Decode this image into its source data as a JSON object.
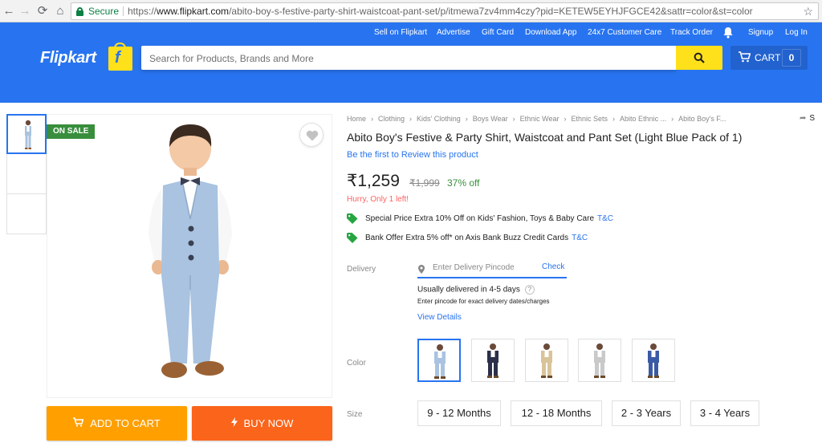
{
  "browser": {
    "secure_label": "Secure",
    "url_scheme": "https://",
    "url_host": "www.flipkart.com",
    "url_path": "/abito-boy-s-festive-party-shirt-waistcoat-pant-set/p/itmewa7zv4mm4czy?pid=KETEW5EYHJFGCE42&sattr=color&st=color"
  },
  "header": {
    "logo": "Flipkart",
    "links": [
      "Sell on Flipkart",
      "Advertise",
      "Gift Card",
      "Download App",
      "24x7 Customer Care",
      "Track Order",
      "Signup",
      "Log In"
    ],
    "search_placeholder": "Search for Products, Brands and More",
    "cart_label": "CART",
    "cart_count": "0"
  },
  "gallery": {
    "sale_badge": "ON SALE",
    "add_to_cart": "ADD TO CART",
    "buy_now": "BUY NOW"
  },
  "breadcrumbs": [
    "Home",
    "Clothing",
    "Kids' Clothing",
    "Boys Wear",
    "Ethnic Wear",
    "Ethnic Sets",
    "Abito Ethnic ...",
    "Abito Boy's F..."
  ],
  "share_label": "S",
  "product": {
    "title": "Abito Boy's Festive & Party Shirt, Waistcoat and Pant Set  (Light Blue Pack of 1)",
    "review_link": "Be the first to Review this product",
    "price": "₹1,259",
    "mrp": "₹1,999",
    "discount": "37% off",
    "hurry": "Hurry, Only 1 left!"
  },
  "offers": [
    {
      "text": "Special Price Extra 10% Off on Kids' Fashion, Toys & Baby Care",
      "tc": "T&C"
    },
    {
      "text": "Bank Offer Extra 5% off* on Axis Bank Buzz Credit Cards",
      "tc": "T&C"
    }
  ],
  "delivery": {
    "label": "Delivery",
    "placeholder": "Enter Delivery Pincode",
    "check": "Check",
    "eta": "Usually delivered in 4-5 days",
    "help": "?",
    "note": "Enter pincode for exact delivery dates/charges",
    "view_details": "View Details"
  },
  "color": {
    "label": "Color",
    "swatches": [
      {
        "vest": "#a9c3e0",
        "pants": "#a9c3e0",
        "shirt": "#ffffff"
      },
      {
        "vest": "#2b2f4a",
        "pants": "#2b2f4a",
        "shirt": "#ffffff"
      },
      {
        "vest": "#d9c49a",
        "pants": "#d9c49a",
        "shirt": "#ffffff"
      },
      {
        "vest": "#c9c9c9",
        "pants": "#c9c9c9",
        "shirt": "#ffffff"
      },
      {
        "vest": "#3b5aa6",
        "pants": "#3b5aa6",
        "shirt": "#ffffff"
      }
    ]
  },
  "size": {
    "label": "Size",
    "options": [
      "9 - 12 Months",
      "12 - 18 Months",
      "2 - 3 Years",
      "3 - 4 Years"
    ]
  },
  "colors": {
    "brand_blue": "#2874f0",
    "brand_yellow": "#ffe11b",
    "cart_orange": "#ff9f00",
    "buy_orange": "#fb641b",
    "success_green": "#388e3c",
    "alert_red": "#ff6161"
  }
}
